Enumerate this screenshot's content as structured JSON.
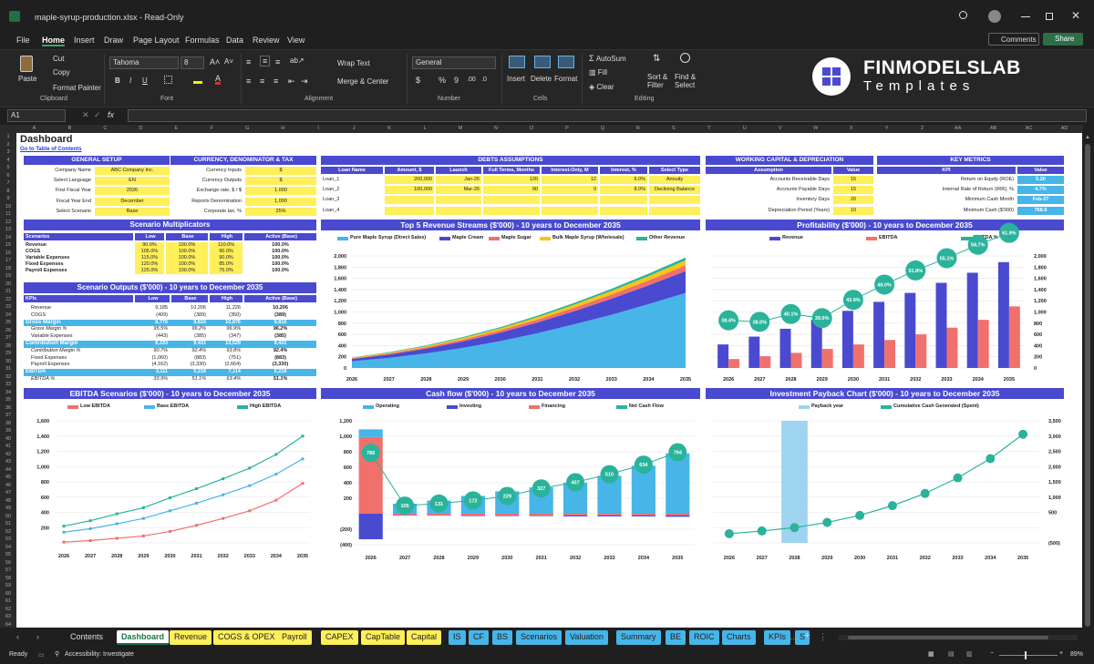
{
  "window": {
    "title": "maple-syrup-production.xlsx  -  Read-Only"
  },
  "menu": {
    "items": [
      "File",
      "Home",
      "Insert",
      "Draw",
      "Page Layout",
      "Formulas",
      "Data",
      "Review",
      "View"
    ],
    "comments": "Comments",
    "share": "Share"
  },
  "ribbon": {
    "paste": "Paste",
    "cut": "Cut",
    "copy": "Copy",
    "format_painter": "Format Painter",
    "clipboard": "Clipboard",
    "font_name": "Tahoma",
    "font_size": "8",
    "font": "Font",
    "wrap_text": "Wrap Text",
    "merge_center": "Merge & Center",
    "alignment": "Alignment",
    "number_format": "General",
    "number": "Number",
    "insert": "Insert",
    "delete": "Delete",
    "format": "Format",
    "cells": "Cells",
    "autosum": "AutoSum",
    "fill": "Fill",
    "clear": "Clear",
    "sort_filter": "Sort &\nFilter",
    "find_select": "Find &\nSelect",
    "editing": "Editing",
    "brand_name": "FINMODELSLAB",
    "brand_sub": "Templates"
  },
  "formula_bar": {
    "name_box": "A1",
    "fx": "fx",
    "value": ""
  },
  "columns": [
    "A",
    "B",
    "C",
    "D",
    "E",
    "F",
    "G",
    "H",
    "I",
    "J",
    "K",
    "L",
    "M",
    "N",
    "O",
    "P",
    "Q",
    "R",
    "S",
    "T",
    "U",
    "V",
    "W",
    "X",
    "Y",
    "Z",
    "AA",
    "AB",
    "AC",
    "AD"
  ],
  "sheet": {
    "title": "Dashboard",
    "link": "Go to Table of Contents",
    "general": {
      "header": "GENERAL SETUP",
      "rows": [
        [
          "Company Name",
          "ABC Company Inc."
        ],
        [
          "Select Language",
          "EN"
        ],
        [
          "First Fiscal Year",
          "2026"
        ],
        [
          "Fiscal Year End",
          "December"
        ],
        [
          "Select Scenario",
          "Base"
        ]
      ]
    },
    "currency": {
      "header": "CURRENCY, DENOMINATOR & TAX",
      "rows": [
        [
          "Currency Inputs",
          "$"
        ],
        [
          "Currency Outputs",
          "$"
        ],
        [
          "Exchange rate, $ / $",
          "1.000"
        ],
        [
          "Reports Denomination",
          "1,000"
        ],
        [
          "Corporate tax, %",
          "25%"
        ]
      ]
    },
    "debts": {
      "header": "DEBTS ASSUMPTIONS",
      "cols": [
        "Loan Name",
        "Amount, $",
        "Launch",
        "Full Terms, Months",
        "Interest-Only, M",
        "Interest, %",
        "Select Type"
      ],
      "rows": [
        [
          "Loan_1",
          "200,000",
          "Jan-26",
          "120",
          "12",
          "6.0%",
          "Annuity"
        ],
        [
          "Loan_2",
          "100,000",
          "Mar-26",
          "90",
          "0",
          "8.0%",
          "Declining Balance"
        ],
        [
          "Loan_3",
          "",
          "",
          "",
          "",
          "",
          ""
        ],
        [
          "Loan_4",
          "",
          "",
          "",
          "",
          "",
          ""
        ]
      ]
    },
    "wc": {
      "header": "WORKING CAPITAL & DEPRECIATION",
      "cols": [
        "Assumption",
        "Value"
      ],
      "rows": [
        [
          "Accounts Receivable Days",
          "15"
        ],
        [
          "Accounts Payable Days",
          "15"
        ],
        [
          "Inventory Days",
          "20"
        ],
        [
          "Depreciation Period (Years)",
          "10"
        ]
      ]
    },
    "kpi": {
      "header": "KEY METRICS",
      "cols": [
        "KPI",
        "Value"
      ],
      "rows": [
        [
          "Return on Equity (ROE)",
          "5.20"
        ],
        [
          "Internal Rate of Return (IRR), %",
          "4.7%"
        ],
        [
          "Minimum Cash Month",
          "Feb-27"
        ],
        [
          "Minimum Cash ($'000)",
          "768.6"
        ]
      ]
    },
    "multipliers": {
      "header": "Scenario Multiplicators",
      "cols": [
        "Scenarios",
        "Low",
        "Base",
        "High",
        "Active (Base)"
      ],
      "rows": [
        [
          "Revenue",
          "90.0%",
          "100.0%",
          "110.0%",
          "100.0%"
        ],
        [
          "COGS",
          "105.0%",
          "100.0%",
          "90.0%",
          "100.0%"
        ],
        [
          "Variable Expenses",
          "115.0%",
          "100.0%",
          "90.0%",
          "100.0%"
        ],
        [
          "Fixed Expenses",
          "120.0%",
          "100.0%",
          "85.0%",
          "100.0%"
        ],
        [
          "Payroll Expenses",
          "125.0%",
          "100.0%",
          "75.0%",
          "100.0%"
        ]
      ]
    },
    "outputs": {
      "header": "Scenario Outputs ($'000) - 10 years to December 2035",
      "cols": [
        "KPIs",
        "Low",
        "Base",
        "High",
        "Active (Base)"
      ],
      "rows": [
        {
          "k": "Revenue",
          "v": [
            "9,185",
            "10,206",
            "11,226",
            "10,206"
          ],
          "style": "plain"
        },
        {
          "k": "COGS",
          "v": [
            "(409)",
            "(389)",
            "(350)",
            "(389)"
          ],
          "style": "plain"
        },
        {
          "k": "Gross Margin",
          "v": [
            "8,776",
            "9,816",
            "10,876",
            "9,816"
          ],
          "style": "band"
        },
        {
          "k": "Gross Margin %",
          "v": [
            "95.5%",
            "96.2%",
            "96.9%",
            "96.2%"
          ],
          "style": "ital"
        },
        {
          "k": "Variable Expenses",
          "v": [
            "(443)",
            "(385)",
            "(347)",
            "(385)"
          ],
          "style": "plain"
        },
        {
          "k": "Contribution Margin",
          "v": [
            "8,333",
            "9,431",
            "10,529",
            "9,431"
          ],
          "style": "band"
        },
        {
          "k": "Contribution Margin %",
          "v": [
            "90.7%",
            "92.4%",
            "93.8%",
            "92.4%"
          ],
          "style": "ital"
        },
        {
          "k": "Fixed Expenses",
          "v": [
            "(1,060)",
            "(883)",
            "(751)",
            "(883)"
          ],
          "style": "plain"
        },
        {
          "k": "Payroll Expenses",
          "v": [
            "(4,162)",
            "(3,330)",
            "(2,664)",
            "(3,330)"
          ],
          "style": "plain"
        },
        {
          "k": "EBITDA",
          "v": [
            "3,111",
            "5,218",
            "7,114",
            "5,218"
          ],
          "style": "band"
        },
        {
          "k": "EBITDA %",
          "v": [
            "33.9%",
            "51.1%",
            "63.4%",
            "51.1%"
          ],
          "style": "ital"
        }
      ]
    },
    "rows_visible": [
      "1",
      "2",
      "3",
      "4",
      "5",
      "6",
      "7",
      "8",
      "9",
      "10",
      "11",
      "12",
      "13",
      "14",
      "15",
      "16",
      "17",
      "18",
      "19",
      "20",
      "21",
      "22",
      "23",
      "24",
      "25",
      "26",
      "27",
      "28",
      "29",
      "30",
      "31",
      "32",
      "33",
      "34",
      "35",
      "36",
      "37",
      "38",
      "39",
      "40",
      "41",
      "42",
      "43",
      "44",
      "45",
      "46",
      "47",
      "48",
      "49",
      "50",
      "51",
      "52",
      "53",
      "54",
      "55",
      "56",
      "57",
      "58",
      "59",
      "60",
      "61",
      "62",
      "63",
      "64"
    ]
  },
  "chart_data": [
    {
      "type": "area",
      "title": "Top 5 Revenue Streams ($'000) - 10 years to December 2035",
      "x": [
        "2026",
        "2027",
        "2028",
        "2029",
        "2030",
        "2031",
        "2032",
        "2033",
        "2034",
        "2035"
      ],
      "series": [
        {
          "name": "Pure Maple Syrup (Direct Sales)",
          "color": "#47b5e8",
          "values": [
            120,
            180,
            260,
            360,
            480,
            620,
            780,
            950,
            1140,
            1340
          ]
        },
        {
          "name": "Maple Cream",
          "color": "#4a4ad0",
          "values": [
            40,
            60,
            85,
            115,
            150,
            190,
            235,
            285,
            335,
            390
          ]
        },
        {
          "name": "Maple Sugar",
          "color": "#f0716b",
          "values": [
            12,
            18,
            25,
            33,
            42,
            52,
            63,
            75,
            88,
            102
          ]
        },
        {
          "name": "Bulk Maple Syrup (Wholesale)",
          "color": "#f5c518",
          "values": [
            10,
            15,
            21,
            28,
            36,
            45,
            55,
            66,
            78,
            91
          ]
        },
        {
          "name": "Other Revenue",
          "color": "#2ab39a",
          "values": [
            6,
            9,
            12,
            16,
            20,
            25,
            30,
            36,
            42,
            48
          ]
        }
      ],
      "ylim": [
        0,
        2000
      ]
    },
    {
      "type": "bar",
      "title": "Profitability ($'000) - 10 years to December 2035",
      "x": [
        "2026",
        "2027",
        "2028",
        "2029",
        "2030",
        "2031",
        "2032",
        "2033",
        "2034",
        "2035"
      ],
      "series": [
        {
          "name": "Revenue",
          "color": "#4a4ad0",
          "values": [
            420,
            560,
            700,
            860,
            1020,
            1180,
            1340,
            1520,
            1700,
            1890
          ]
        },
        {
          "name": "EBITDA",
          "color": "#f0716b",
          "values": [
            160,
            210,
            270,
            340,
            420,
            500,
            600,
            720,
            860,
            1100
          ]
        },
        {
          "name": "EBITDA %",
          "color": "#2ab39a",
          "values": [
            38.4,
            38.0,
            40.1,
            39.0,
            43.9,
            48.0,
            51.8,
            55.1,
            58.7,
            61.9
          ],
          "labels": [
            "38.4%",
            "38.0%",
            "40.1%",
            "39.0%",
            "43.9%",
            "48.0%",
            "51.8%",
            "55.1%",
            "58.7%",
            "61.9%"
          ]
        }
      ],
      "ylim": [
        0,
        2000
      ]
    },
    {
      "type": "line",
      "title": "EBITDA Scenarios ($'000) - 10 years to December 2035",
      "x": [
        "2026",
        "2027",
        "2028",
        "2029",
        "2030",
        "2031",
        "2032",
        "2033",
        "2034",
        "2035"
      ],
      "series": [
        {
          "name": "Low EBITDA",
          "color": "#f0716b",
          "values": [
            10,
            30,
            60,
            90,
            150,
            230,
            320,
            420,
            560,
            780
          ]
        },
        {
          "name": "Base EBITDA",
          "color": "#47b5e8",
          "values": [
            140,
            185,
            250,
            320,
            420,
            520,
            630,
            750,
            900,
            1100
          ]
        },
        {
          "name": "High EBITDA",
          "color": "#2ab39a",
          "values": [
            220,
            290,
            380,
            460,
            590,
            710,
            840,
            980,
            1160,
            1400
          ]
        }
      ],
      "ylim": [
        0,
        1600
      ]
    },
    {
      "type": "bar",
      "title": "Cash flow ($'000) - 10 years to December 2035",
      "x": [
        "2026",
        "2027",
        "2028",
        "2029",
        "2030",
        "2031",
        "2032",
        "2033",
        "2034",
        "2035"
      ],
      "series": [
        {
          "name": "Operating",
          "color": "#47b5e8",
          "values": [
            100,
            130,
            170,
            230,
            290,
            340,
            400,
            490,
            620,
            780
          ]
        },
        {
          "name": "Investing",
          "color": "#4a4ad0",
          "values": [
            -330,
            -5,
            -5,
            -10,
            -10,
            -10,
            -15,
            -15,
            -15,
            -20
          ]
        },
        {
          "name": "Financing",
          "color": "#f0716b",
          "values": [
            990,
            -20,
            -20,
            -20,
            -20,
            -20,
            -20,
            -20,
            -20,
            -20
          ]
        },
        {
          "name": "Net Cash Flow",
          "color": "#2ab39a",
          "values": [
            786,
            105,
            131,
            172,
            229,
            327,
            407,
            510,
            634,
            794
          ],
          "labels": [
            "786",
            "105",
            "131",
            "172",
            "229",
            "327",
            "407",
            "510",
            "634",
            "794"
          ]
        }
      ],
      "ylim": [
        -400,
        1200
      ]
    },
    {
      "type": "line",
      "title": "Investment Payback Chart ($'000) - 10 years to December 2035",
      "x": [
        "2026",
        "2027",
        "2028",
        "2029",
        "2030",
        "2031",
        "2032",
        "2033",
        "2034",
        "2035"
      ],
      "series": [
        {
          "name": "Payback year",
          "color": "#9ed4f0",
          "values": [
            0,
            0,
            1,
            0,
            0,
            0,
            0,
            0,
            0,
            0
          ]
        },
        {
          "name": "Cumulative Cash Generated (Spent)",
          "color": "#2ab39a",
          "values": [
            -200,
            -110,
            0,
            170,
            400,
            720,
            1120,
            1630,
            2260,
            3060
          ]
        }
      ],
      "ylim": [
        -500,
        3500
      ]
    }
  ],
  "tabs": [
    {
      "label": "Contents",
      "style": "plain"
    },
    {
      "label": "Dashboard",
      "style": "active"
    },
    {
      "label": "Revenue",
      "style": "yellow"
    },
    {
      "label": "COGS & OPEX",
      "style": "yellow"
    },
    {
      "label": "Payroll",
      "style": "yellow"
    },
    {
      "label": "CAPEX",
      "style": "yellow"
    },
    {
      "label": "CapTable",
      "style": "yellow"
    },
    {
      "label": "Capital",
      "style": "yellow"
    },
    {
      "label": "IS",
      "style": "blue"
    },
    {
      "label": "CF",
      "style": "blue"
    },
    {
      "label": "BS",
      "style": "blue"
    },
    {
      "label": "Scenarios",
      "style": "blue"
    },
    {
      "label": "Valuation",
      "style": "blue"
    },
    {
      "label": "Summary",
      "style": "blue"
    },
    {
      "label": "BE",
      "style": "blue"
    },
    {
      "label": "ROIC",
      "style": "blue"
    },
    {
      "label": "Charts",
      "style": "blue"
    },
    {
      "label": "KPIs",
      "style": "blue"
    },
    {
      "label": "S",
      "style": "blue"
    }
  ],
  "status": {
    "ready": "Ready",
    "accessibility": "Accessibility: Investigate",
    "zoom": "89%"
  },
  "colors": {
    "accent": "#4a4ad0",
    "yellow": "#ffef5a",
    "blue": "#47b5e8",
    "teal": "#2ab39a",
    "salmon": "#f0716b"
  }
}
